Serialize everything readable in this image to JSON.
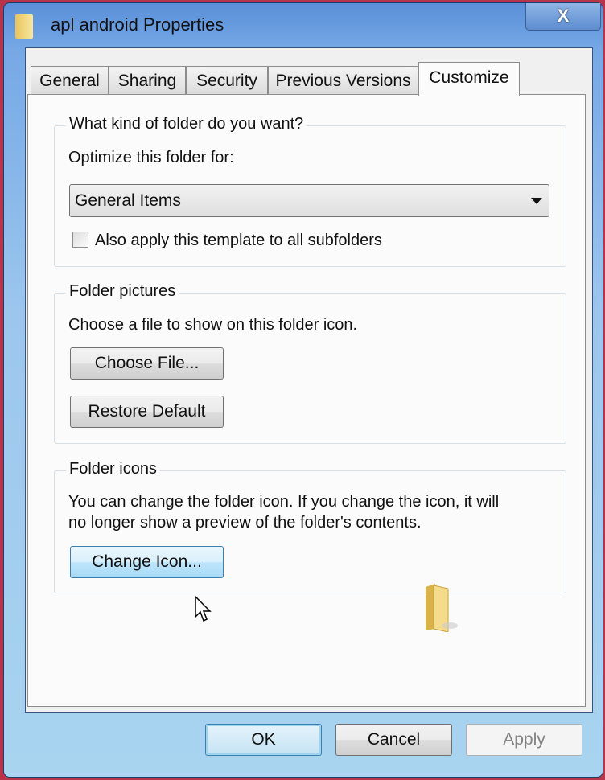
{
  "window": {
    "title": "apl android Properties",
    "close_label": "X",
    "icon": "folder-icon"
  },
  "tabs": [
    {
      "label": "General",
      "active": false
    },
    {
      "label": "Sharing",
      "active": false
    },
    {
      "label": "Security",
      "active": false
    },
    {
      "label": "Previous Versions",
      "active": false
    },
    {
      "label": "Customize",
      "active": true
    }
  ],
  "folder_type": {
    "legend": "What kind of folder do you want?",
    "optimize_label": "Optimize this folder for:",
    "selected": "General Items",
    "apply_subfolders_label": "Also apply this template to all subfolders",
    "apply_subfolders_checked": false
  },
  "folder_pictures": {
    "legend": "Folder pictures",
    "description": "Choose a file to show on this folder icon.",
    "choose_file": "Choose File...",
    "restore_default": "Restore Default"
  },
  "folder_icons": {
    "legend": "Folder icons",
    "description_line1": "You can change the folder icon. If you change the icon, it will",
    "description_line2": "no longer show a preview of the folder's contents.",
    "change_icon": "Change Icon...",
    "preview_icon": "folder-icon"
  },
  "footer": {
    "ok": "OK",
    "cancel": "Cancel",
    "apply": "Apply"
  }
}
